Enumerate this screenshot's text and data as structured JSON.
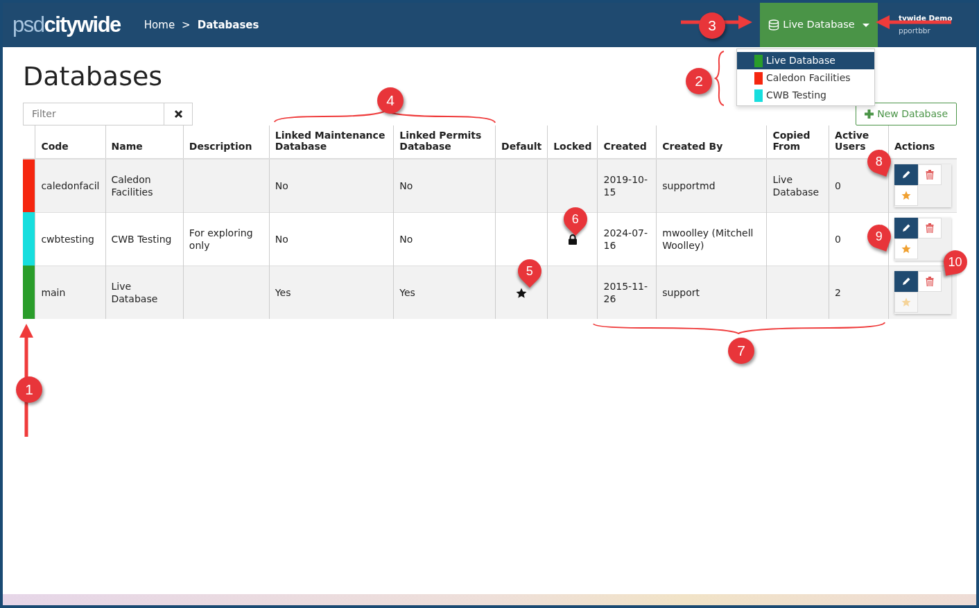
{
  "header": {
    "logo": {
      "light": "psd",
      "bold": "citywide"
    },
    "breadcrumb": [
      {
        "label": "Home",
        "current": false
      },
      {
        "label": "Databases",
        "current": true
      }
    ],
    "separator": ">",
    "database_menu": {
      "label": "Live Database",
      "expanded": true,
      "items": [
        {
          "label": "Live Database",
          "color": "#2a9d2a",
          "selected": true
        },
        {
          "label": "Caledon Facilities",
          "color": "#f5260f",
          "selected": false
        },
        {
          "label": "CWB Testing",
          "color": "#17dede",
          "selected": false
        }
      ]
    },
    "user": {
      "name": "tywide Demo",
      "login": "pportbbr"
    }
  },
  "page": {
    "title": "Databases",
    "filter": {
      "placeholder": "Filter"
    },
    "new_button": "New Database"
  },
  "table": {
    "columns": [
      "Code",
      "Name",
      "Description",
      "Linked Maintenance Database",
      "Linked Permits Database",
      "Default",
      "Locked",
      "Created",
      "Created By",
      "Copied From",
      "Active Users",
      "Actions"
    ],
    "rows": [
      {
        "color": "#f5260f",
        "code": "caledonfacil",
        "name": "Caledon Facilities",
        "linked_maintenance": "No",
        "linked_permits": "No",
        "default": false,
        "locked": false,
        "created": "2019-10-15",
        "created_by": "supportmd",
        "copied_from": "Live Database",
        "active_users": "0",
        "star_disabled": false
      },
      {
        "color": "#17dede",
        "code": "cwbtesting",
        "name": "CWB Testing",
        "description": "For exploring only",
        "linked_maintenance": "No",
        "linked_permits": "No",
        "default": false,
        "locked": true,
        "created": "2024-07-16",
        "created_by": "mwoolley (Mitchell Woolley)",
        "active_users": "0",
        "star_disabled": false
      },
      {
        "color": "#2a9d2a",
        "code": "main",
        "name": "Live Database",
        "linked_maintenance": "Yes",
        "linked_permits": "Yes",
        "default": true,
        "locked": false,
        "created": "2015-11-26",
        "created_by": "support",
        "active_users": "2",
        "star_disabled": true
      }
    ]
  },
  "annotations": [
    {
      "label": "1",
      "kind": "circle"
    },
    {
      "label": "2",
      "kind": "circle"
    },
    {
      "label": "3",
      "kind": "circle"
    },
    {
      "label": "4",
      "kind": "circle"
    },
    {
      "label": "5",
      "kind": "pin"
    },
    {
      "label": "6",
      "kind": "pin"
    },
    {
      "label": "7",
      "kind": "circle"
    },
    {
      "label": "8",
      "kind": "pin"
    },
    {
      "label": "9",
      "kind": "pin"
    },
    {
      "label": "10",
      "kind": "pin"
    }
  ]
}
